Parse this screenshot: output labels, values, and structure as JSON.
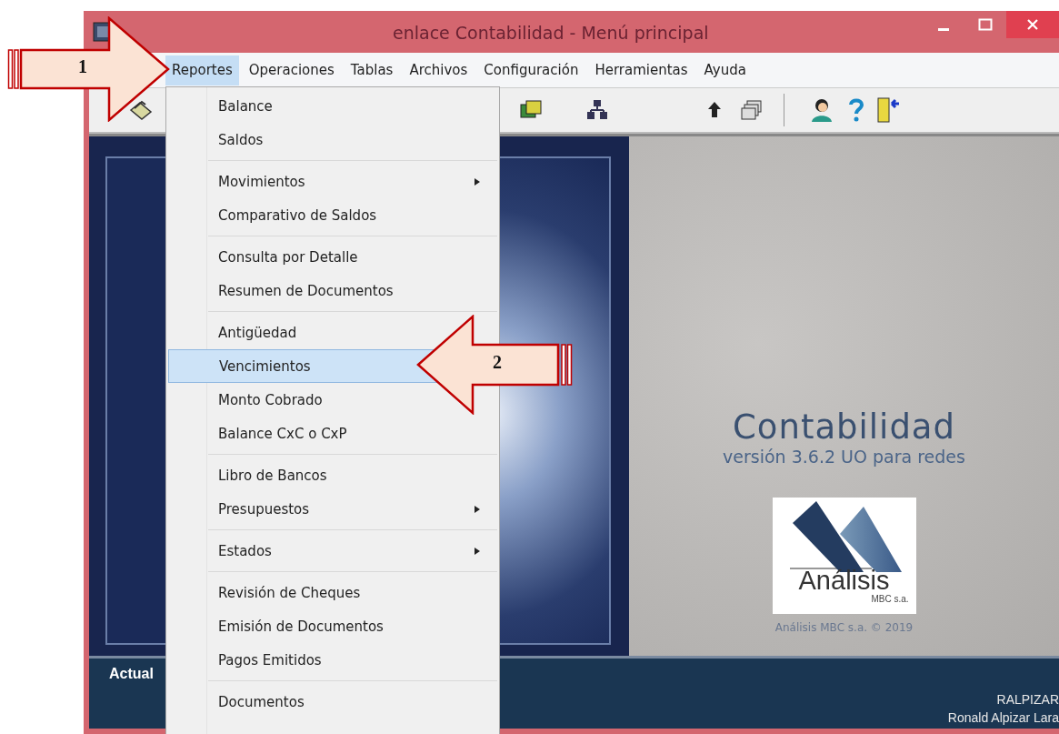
{
  "window": {
    "title": "enlace Contabilidad - Menú principal"
  },
  "menu_bar": [
    {
      "label": "Reportes",
      "selected": true
    },
    {
      "label": "Operaciones",
      "selected": false
    },
    {
      "label": "Tablas",
      "selected": false
    },
    {
      "label": "Archivos",
      "selected": false
    },
    {
      "label": "Configuración",
      "selected": false
    },
    {
      "label": "Herramientas",
      "selected": false
    },
    {
      "label": "Ayuda",
      "selected": false
    }
  ],
  "dropdown": {
    "groups": [
      [
        {
          "label": "Balance",
          "kind": "item",
          "selected": false
        },
        {
          "label": "Saldos",
          "kind": "item",
          "selected": false
        }
      ],
      [
        {
          "label": "Movimientos",
          "kind": "submenu",
          "selected": false
        },
        {
          "label": "Comparativo de Saldos",
          "kind": "item",
          "selected": false
        }
      ],
      [
        {
          "label": "Consulta por Detalle",
          "kind": "item",
          "selected": false
        },
        {
          "label": "Resumen de Documentos",
          "kind": "item",
          "selected": false
        }
      ],
      [
        {
          "label": "Antigüedad",
          "kind": "item",
          "selected": false
        },
        {
          "label": "Vencimientos",
          "kind": "item",
          "selected": true
        },
        {
          "label": "Monto Cobrado",
          "kind": "item",
          "selected": false
        },
        {
          "label": "Balance CxC o CxP",
          "kind": "item",
          "selected": false
        }
      ],
      [
        {
          "label": "Libro de Bancos",
          "kind": "item",
          "selected": false
        },
        {
          "label": "Presupuestos",
          "kind": "submenu",
          "selected": false
        }
      ],
      [
        {
          "label": "Estados",
          "kind": "submenu",
          "selected": false
        }
      ],
      [
        {
          "label": "Revisión de Cheques",
          "kind": "item",
          "selected": false
        },
        {
          "label": "Emisión de Documentos",
          "kind": "item",
          "selected": false
        },
        {
          "label": "Pagos Emitidos",
          "kind": "item",
          "selected": false
        }
      ],
      [
        {
          "label": "Documentos",
          "kind": "item",
          "selected": false
        }
      ]
    ]
  },
  "splash": {
    "title": "Contabilidad",
    "subtitle": "versión 3.6.2 UO para redes",
    "logo_text": "Análisis",
    "logo_subtext": "MBC s.a.",
    "copyright": "Análisis MBC s.a. © 2019"
  },
  "status_bar": {
    "label": "Actual",
    "user_id": "RALPIZAR",
    "user_name": "Ronald Alpizar Lara"
  },
  "callouts": [
    {
      "label": "1",
      "kind": "right"
    },
    {
      "label": "2",
      "kind": "left"
    }
  ]
}
